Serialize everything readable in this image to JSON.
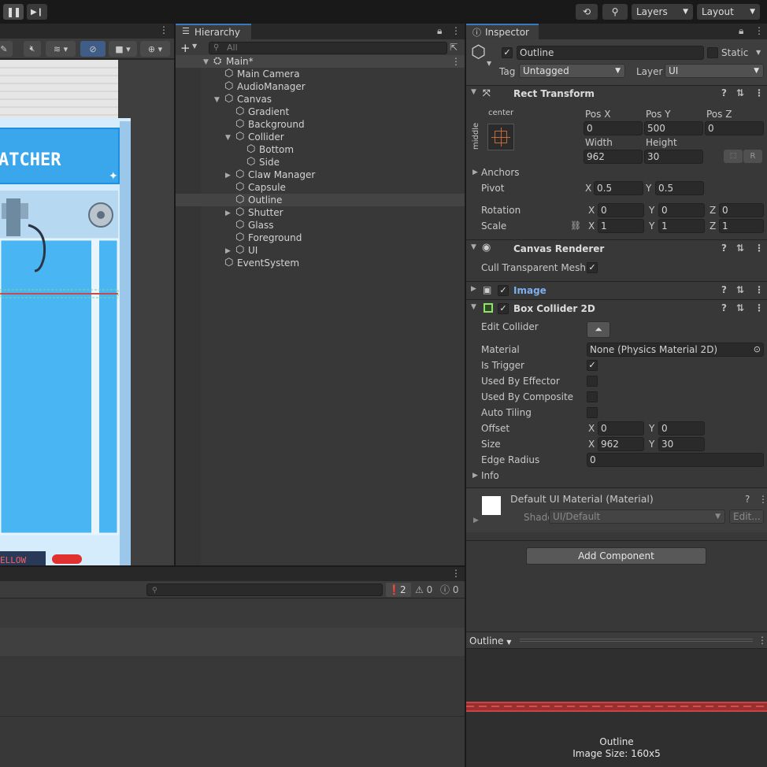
{
  "toolbar": {
    "history_icon": "history-icon",
    "search_icon": "search-icon",
    "layers_label": "Layers",
    "layout_label": "Layout"
  },
  "hierarchy": {
    "tab_label": "Hierarchy",
    "search_placeholder": "All",
    "add_label": "+",
    "items": [
      {
        "label": "Main*",
        "depth": 0,
        "expand": "open",
        "icon": "unity-scene-icon"
      },
      {
        "label": "Main Camera",
        "depth": 1,
        "expand": "none",
        "icon": "gameobject-icon"
      },
      {
        "label": "AudioManager",
        "depth": 1,
        "expand": "none",
        "icon": "gameobject-icon"
      },
      {
        "label": "Canvas",
        "depth": 1,
        "expand": "open",
        "icon": "gameobject-icon"
      },
      {
        "label": "Gradient",
        "depth": 2,
        "expand": "none",
        "icon": "gameobject-icon"
      },
      {
        "label": "Background",
        "depth": 2,
        "expand": "none",
        "icon": "gameobject-icon"
      },
      {
        "label": "Collider",
        "depth": 2,
        "expand": "open",
        "icon": "gameobject-icon"
      },
      {
        "label": "Bottom",
        "depth": 3,
        "expand": "none",
        "icon": "gameobject-icon"
      },
      {
        "label": "Side",
        "depth": 3,
        "expand": "none",
        "icon": "gameobject-icon"
      },
      {
        "label": "Claw Manager",
        "depth": 2,
        "expand": "closed",
        "icon": "gameobject-icon"
      },
      {
        "label": "Capsule",
        "depth": 2,
        "expand": "none",
        "icon": "gameobject-icon"
      },
      {
        "label": "Outline",
        "depth": 2,
        "expand": "none",
        "icon": "gameobject-icon",
        "selected": true
      },
      {
        "label": "Shutter",
        "depth": 2,
        "expand": "closed",
        "icon": "gameobject-icon"
      },
      {
        "label": "Glass",
        "depth": 2,
        "expand": "none",
        "icon": "gameobject-icon"
      },
      {
        "label": "Foreground",
        "depth": 2,
        "expand": "none",
        "icon": "gameobject-icon"
      },
      {
        "label": "UI",
        "depth": 2,
        "expand": "closed",
        "icon": "gameobject-icon"
      },
      {
        "label": "EventSystem",
        "depth": 1,
        "expand": "none",
        "icon": "gameobject-icon"
      }
    ]
  },
  "game": {
    "title_text": "ATCHER",
    "button_text": "ELLOW"
  },
  "console": {
    "errors": "2",
    "warnings": "0",
    "infos": "0"
  },
  "inspector": {
    "tab_label": "Inspector",
    "object_name": "Outline",
    "static_label": "Static",
    "tag_label": "Tag",
    "tag_value": "Untagged",
    "layer_label": "Layer",
    "layer_value": "UI",
    "rect_transform": {
      "title": "Rect Transform",
      "anchor_h": "center",
      "anchor_v": "middle",
      "posx_label": "Pos X",
      "posy_label": "Pos Y",
      "posz_label": "Pos Z",
      "posx": "0",
      "posy": "500",
      "posz": "0",
      "width_label": "Width",
      "height_label": "Height",
      "width": "962",
      "height": "30",
      "anchors_label": "Anchors",
      "pivot_label": "Pivot",
      "pivot_x": "0.5",
      "pivot_y": "0.5",
      "rotation_label": "Rotation",
      "rot_x": "0",
      "rot_y": "0",
      "rot_z": "0",
      "scale_label": "Scale",
      "scale_x": "1",
      "scale_y": "1",
      "scale_z": "1",
      "r_button": "R"
    },
    "canvas_renderer": {
      "title": "Canvas Renderer",
      "cull_label": "Cull Transparent Mesh"
    },
    "image": {
      "title": "Image"
    },
    "box_collider": {
      "title": "Box Collider 2D",
      "edit_label": "Edit Collider",
      "material_label": "Material",
      "material_value": "None (Physics Material 2D)",
      "trigger_label": "Is Trigger",
      "effector_label": "Used By Effector",
      "composite_label": "Used By Composite",
      "tiling_label": "Auto Tiling",
      "offset_label": "Offset",
      "offset_x": "0",
      "offset_y": "0",
      "size_label": "Size",
      "size_x": "962",
      "size_y": "30",
      "edge_label": "Edge Radius",
      "edge_value": "0",
      "info_label": "Info"
    },
    "material": {
      "title": "Default UI Material (Material)",
      "shader_label": "Shader",
      "shader_value": "UI/Default",
      "edit_label": "Edit..."
    },
    "add_component": "Add Component",
    "preview": {
      "dropdown": "Outline",
      "name": "Outline",
      "size_text": "Image Size: 160x5"
    }
  },
  "colors": {
    "selection": "#3a79bb",
    "link": "#6ca9ff",
    "outline_red": "#c83c3c"
  }
}
